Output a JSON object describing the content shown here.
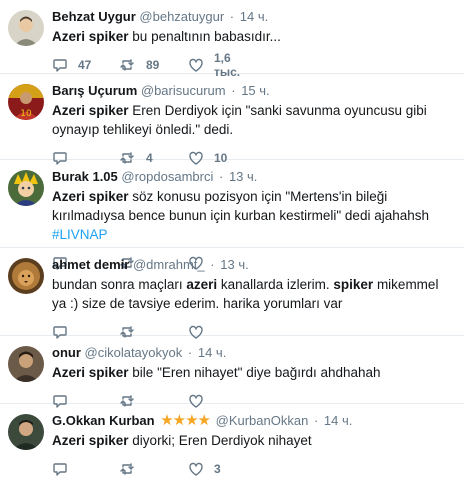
{
  "tweets": [
    {
      "name": "Behzat Uygur",
      "handle": "@behzatuygur",
      "time": "14 ч.",
      "text_bold": "Azeri spiker",
      "text_rest": " bu penaltının babasıdır...",
      "reply_count": "47",
      "retweet_count": "89",
      "like_count": "1,6 тыс.",
      "avatar_color": "#c8c2b4"
    },
    {
      "name": "Barış Uçurum",
      "handle": "@barisucurum",
      "time": "15 ч.",
      "text_bold": "Azeri spiker",
      "text_rest": " Eren Derdiyok için \"sanki savunma oyuncusu gibi oynayıp tehlikeyi önledi.\" dedi.",
      "reply_count": "",
      "retweet_count": "4",
      "like_count": "10",
      "avatar_color": "#c0392b"
    },
    {
      "name": "Burak 1.05",
      "handle": "@ropdosambrci",
      "time": "13 ч.",
      "text_bold": "Azeri spiker",
      "text_rest": " söz konusu pozisyon için \"Mertens'in bileği kırılmadıysa bence bunun için kurban kestirmeli\" dedi ajahahsh ",
      "hashtag": "#LIVNAP",
      "reply_count": "",
      "retweet_count": "",
      "like_count": "",
      "avatar_color": "#3a5a2a"
    },
    {
      "name": "ahmet demir",
      "handle": "@dmrahmt_",
      "time": "13 ч.",
      "text_p1": "bundan sonra maçları ",
      "text_b1": "azeri",
      "text_p2": " kanallarda izlerim. ",
      "text_b2": "spiker",
      "text_p3": " mikemmel ya :) size de tavsiye ederim. harika yorumları var",
      "reply_count": "",
      "retweet_count": "",
      "like_count": "",
      "avatar_color": "#7a5a2e"
    },
    {
      "name": "onur",
      "handle": "@cikolatayokyok",
      "time": "14 ч.",
      "text_bold": "Azeri spiker",
      "text_rest": " bile \"Eren nihayet\" diye bağırdı ahdhahah",
      "reply_count": "",
      "retweet_count": "",
      "like_count": "",
      "avatar_color": "#5a4a3a"
    },
    {
      "name": "G.Okkan Kurban",
      "stars": "★★★★",
      "handle": "@KurbanOkkan",
      "time": "14 ч.",
      "text_bold": "Azeri spiker",
      "text_rest": " diyorki; Eren Derdiyok nihayet",
      "reply_count": "",
      "retweet_count": "",
      "like_count": "3",
      "avatar_color": "#2f3a2f"
    }
  ],
  "separator": "·",
  "icons": {
    "reply": "reply-icon",
    "retweet": "retweet-icon",
    "like": "like-icon"
  },
  "colors": {
    "link": "#1da1f2",
    "meta": "#657786",
    "text": "#14171a",
    "divider": "#e6ecf0",
    "stars": "#f5a623"
  }
}
